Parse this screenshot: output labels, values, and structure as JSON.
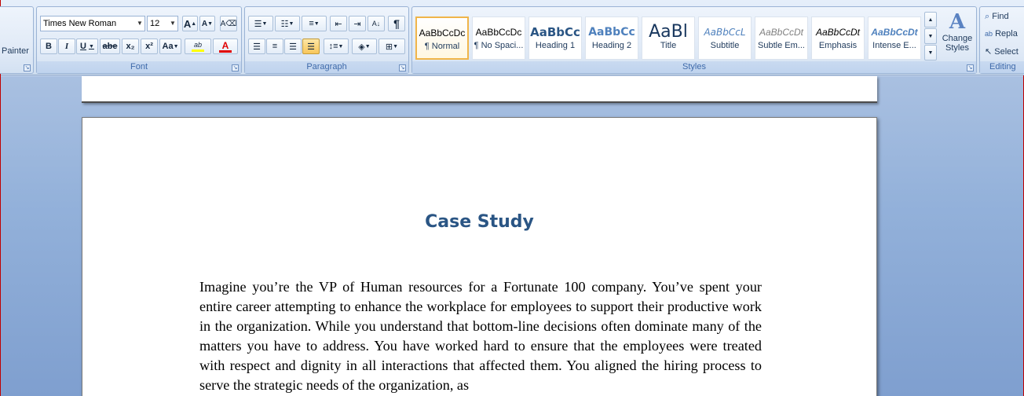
{
  "clipboard": {
    "painter_label": "Painter"
  },
  "font": {
    "group_label": "Font",
    "font_name": "Times New Roman",
    "font_size": "12",
    "grow_label": "A",
    "shrink_label": "A",
    "bold": "B",
    "italic": "I",
    "underline": "U",
    "strikethrough": "abe",
    "subscript": "x₂",
    "superscript": "x²",
    "change_case": "Aa",
    "highlight": "ab",
    "font_color": "A"
  },
  "paragraph": {
    "group_label": "Paragraph",
    "show_marks": "¶"
  },
  "styles": {
    "group_label": "Styles",
    "items": [
      {
        "sample": "AaBbCcDc",
        "name": "¶ Normal"
      },
      {
        "sample": "AaBbCcDc",
        "name": "¶ No Spaci..."
      },
      {
        "sample": "AaBbCc",
        "name": "Heading 1"
      },
      {
        "sample": "AaBbCc",
        "name": "Heading 2"
      },
      {
        "sample": "AaBl",
        "name": "Title"
      },
      {
        "sample": "AaBbCcL",
        "name": "Subtitle"
      },
      {
        "sample": "AaBbCcDt",
        "name": "Subtle Em..."
      },
      {
        "sample": "AaBbCcDt",
        "name": "Emphasis"
      },
      {
        "sample": "AaBbCcDt",
        "name": "Intense E..."
      }
    ],
    "change_styles_line1": "Change",
    "change_styles_line2": "Styles"
  },
  "editing": {
    "group_label": "Editing",
    "find": "Find",
    "replace": "Repla",
    "select": "Select"
  },
  "document": {
    "title": "Case Study",
    "body": "Imagine you’re the VP of Human resources for a Fortunate 100 company. You’ve spent your entire career attempting to enhance the workplace for employees to support their productive work in the organization. While you understand that bottom-line decisions often dominate many of the matters you have to address. You have worked hard to ensure that the employees were treated with respect and dignity in all interactions that affected them. You aligned the hiring process to serve the strategic needs of the organization, as"
  },
  "colors": {
    "accent": "#2a5584",
    "selected_style_border": "#f0b54a",
    "font_color_bar": "#e00000",
    "highlight_bar": "#ffff00"
  }
}
